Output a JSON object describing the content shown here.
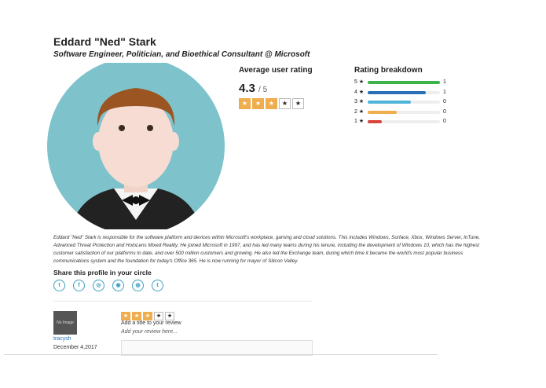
{
  "profile": {
    "name": "Eddard \"Ned\" Stark",
    "subtitle": "Software Engineer, Politician, and Bioethical Consultant @ Microsoft",
    "bio": "Eddard \"Ned\" Stark is responsible for the software platform and devices within Microsoft's workplace, gaming and cloud solutions. This includes Windows, Surface, Xbox, Windows Server, InTune, Advanced Threat Protection and HoloLens Mixed Reality. He joined Microsoft in 1997, and has led many teams during his tenure, including the development of Windows 10, which has the highest customer satisfaction of our platforms to date, and over 500 million customers and growing. He also led the Exchange team, during which time it became the world's most popular business communications system and the foundation for today's Office 365. He is now running for mayor of Silicon Valley."
  },
  "rating": {
    "heading": "Average user rating",
    "value": "4.3",
    "out_of": "/ 5",
    "stars": [
      true,
      true,
      true,
      false,
      false
    ],
    "star_glyph": "★",
    "star_color": "#f0ad4e"
  },
  "breakdown": {
    "heading": "Rating breakdown",
    "rows": [
      {
        "label": "5 ★",
        "count": "1",
        "fill": 1.0,
        "color": "#3cb44a"
      },
      {
        "label": "4 ★",
        "count": "1",
        "fill": 0.8,
        "color": "#2a6fb5"
      },
      {
        "label": "3 ★",
        "count": "0",
        "fill": 0.6,
        "color": "#4fb4d8"
      },
      {
        "label": "2 ★",
        "count": "0",
        "fill": 0.4,
        "color": "#f0ad4e"
      },
      {
        "label": "1 ★",
        "count": "0",
        "fill": 0.2,
        "color": "#d9453d"
      }
    ]
  },
  "share": {
    "heading": "Share this profile in your circle",
    "icons": [
      {
        "name": "twitter-icon",
        "glyph": "t"
      },
      {
        "name": "facebook-icon",
        "glyph": "f"
      },
      {
        "name": "instagram-icon",
        "glyph": "◎"
      },
      {
        "name": "github-icon",
        "glyph": "◉"
      },
      {
        "name": "dribbble-icon",
        "glyph": "◍"
      },
      {
        "name": "tumblr-icon",
        "glyph": "t"
      }
    ],
    "color": "#3c9fc4"
  },
  "review": {
    "avatar_text": "No Image",
    "reviewer": "tracysh",
    "date": "December 4,2017",
    "stars": [
      true,
      true,
      true,
      false,
      false
    ],
    "star_glyph": "★",
    "title_placeholder": "Add a title to your review",
    "body_placeholder": "Add your review here..."
  }
}
